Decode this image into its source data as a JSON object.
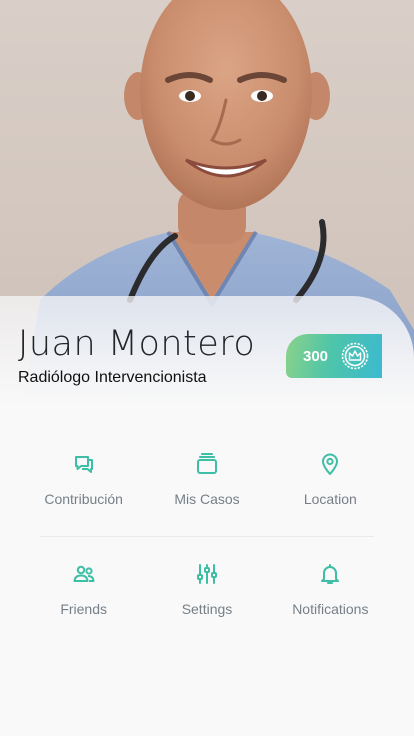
{
  "profile": {
    "name": "Juan Montero",
    "title": "Radiólogo Intervencionista",
    "score": "300"
  },
  "menu": {
    "row1": [
      {
        "label": "Contribución",
        "icon": "chat-bubbles-icon"
      },
      {
        "label": "Mis Casos",
        "icon": "folder-stack-icon"
      },
      {
        "label": "Location",
        "icon": "location-pin-icon"
      }
    ],
    "row2": [
      {
        "label": "Friends",
        "icon": "friends-icon"
      },
      {
        "label": "Settings",
        "icon": "sliders-icon"
      },
      {
        "label": "Notifications",
        "icon": "bell-icon"
      }
    ]
  },
  "colors": {
    "accent": "#3dbfa6",
    "badge_gradient_start": "#8bd28a",
    "badge_gradient_end": "#3bbad0",
    "label": "#767f88",
    "name": "#222629"
  }
}
